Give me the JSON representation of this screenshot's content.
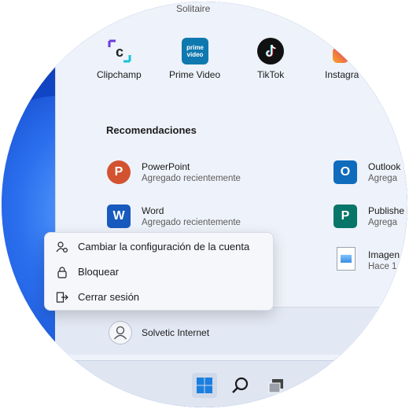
{
  "partial_pinned_top": "Solitaire",
  "pinned_apps": [
    {
      "name": "Clipchamp",
      "icon": "clipchamp-icon"
    },
    {
      "name": "Prime Video",
      "icon": "prime-video-icon",
      "badge_line1": "prime",
      "badge_line2": "video"
    },
    {
      "name": "TikTok",
      "icon": "tiktok-icon"
    },
    {
      "name": "Instagra",
      "icon": "instagram-icon"
    }
  ],
  "recommended": {
    "title": "Recomendaciones",
    "items": [
      {
        "name": "PowerPoint",
        "subtitle": "Agregado recientemente",
        "icon": "powerpoint-icon",
        "letter": "P",
        "color": "#d35230"
      },
      {
        "name": "Outlook",
        "subtitle": "Agrega",
        "icon": "outlook-icon",
        "letter": "O",
        "color": "#0f6cbd"
      },
      {
        "name": "Word",
        "subtitle": "Agregado recientemente",
        "icon": "word-icon",
        "letter": "W",
        "color": "#185abd"
      },
      {
        "name": "Publishe",
        "subtitle": "Agrega",
        "icon": "publisher-icon",
        "letter": "P",
        "color": "#077568"
      },
      {
        "name": "Imagen",
        "subtitle": "Hace 1",
        "icon": "image-file-icon"
      }
    ]
  },
  "account_menu": {
    "items": [
      {
        "label": "Cambiar la configuración de la cuenta",
        "icon": "account-settings-icon"
      },
      {
        "label": "Bloquear",
        "icon": "lock-icon"
      },
      {
        "label": "Cerrar sesión",
        "icon": "sign-out-icon"
      }
    ]
  },
  "user": {
    "name": "Solvetic Internet",
    "icon": "user-avatar-icon"
  },
  "taskbar": {
    "icons": [
      "windows-start-icon",
      "search-icon",
      "task-view-icon"
    ]
  },
  "colors": {
    "accent": "#0f6cbd",
    "menu_bg": "#eef2fa",
    "wallpaper": "#1148c9"
  }
}
